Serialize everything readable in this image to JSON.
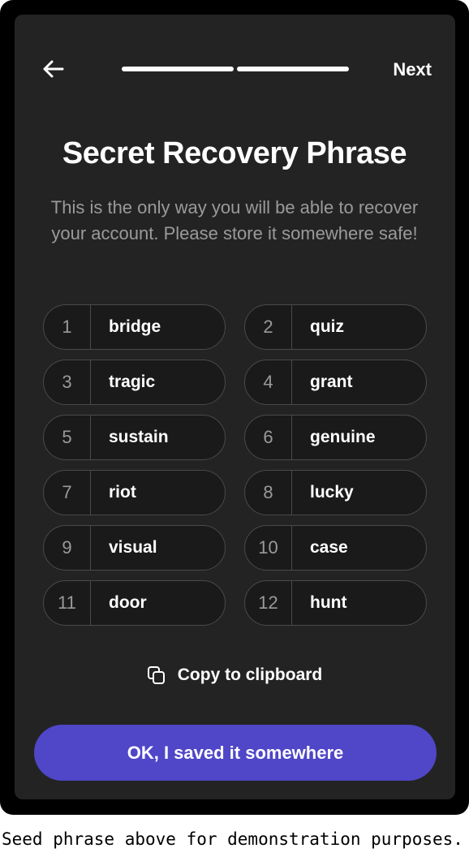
{
  "header": {
    "back_icon": "arrow-left-icon",
    "next_label": "Next",
    "progress_steps": 2,
    "progress_color": "#ffffff"
  },
  "title": "Secret Recovery Phrase",
  "subtitle": "This is the only way you will be able to recover your account. Please store it somewhere safe!",
  "words": [
    {
      "num": "1",
      "word": "bridge"
    },
    {
      "num": "2",
      "word": "quiz"
    },
    {
      "num": "3",
      "word": "tragic"
    },
    {
      "num": "4",
      "word": "grant"
    },
    {
      "num": "5",
      "word": "sustain"
    },
    {
      "num": "6",
      "word": "genuine"
    },
    {
      "num": "7",
      "word": "riot"
    },
    {
      "num": "8",
      "word": "lucky"
    },
    {
      "num": "9",
      "word": "visual"
    },
    {
      "num": "10",
      "word": "case"
    },
    {
      "num": "11",
      "word": "door"
    },
    {
      "num": "12",
      "word": "hunt"
    }
  ],
  "copy": {
    "icon": "copy-icon",
    "label": "Copy to clipboard"
  },
  "primary_button": {
    "label": "OK, I saved it somewhere",
    "color": "#4f46c8"
  },
  "caption": "Seed phrase above for demonstration purposes."
}
